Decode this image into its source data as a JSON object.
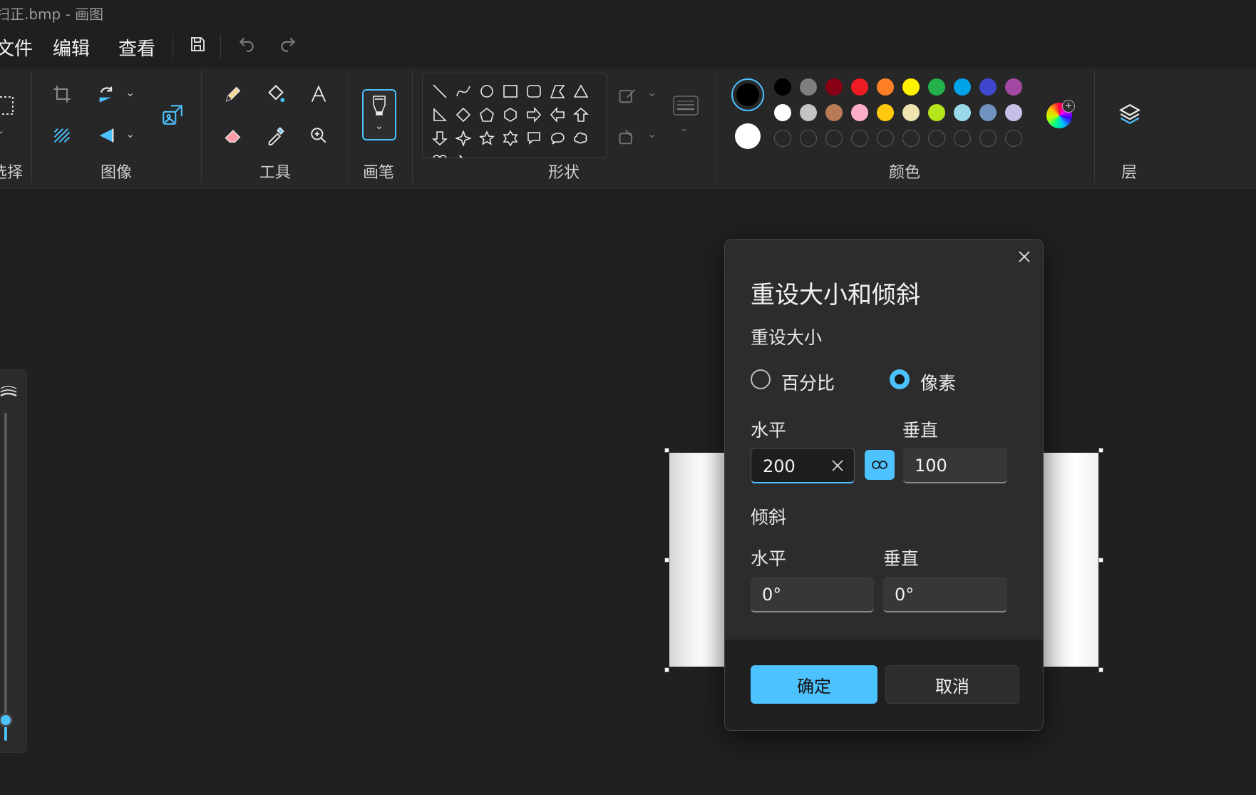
{
  "window": {
    "title": "扫正.bmp - 画图"
  },
  "menu": {
    "items": [
      "文件",
      "编辑",
      "查看"
    ]
  },
  "ribbon": {
    "groups": {
      "selection": "选择",
      "image": "图像",
      "tools": "工具",
      "brushes": "画笔",
      "shapes": "形状",
      "colors": "颜色",
      "layers": "层"
    }
  },
  "colors": {
    "primary": "#000000",
    "secondary": "#ffffff",
    "accent": "#4cc2ff",
    "row1": [
      "#000000",
      "#7f7f7f",
      "#880015",
      "#ed1c24",
      "#ff7f27",
      "#fff200",
      "#22b14c",
      "#00a2e8",
      "#3f48cc",
      "#a349a4"
    ],
    "row2": [
      "#ffffff",
      "#c3c3c3",
      "#b97a57",
      "#ffaec9",
      "#ffc90e",
      "#efe4b0",
      "#b5e61d",
      "#99d9ea",
      "#7092be",
      "#c8bfe7"
    ]
  },
  "dialog": {
    "title": "重设大小和倾斜",
    "resize_heading": "重设大小",
    "option_percent": "百分比",
    "option_pixels": "像素",
    "selected_option": "像素",
    "horizontal_label": "水平",
    "vertical_label": "垂直",
    "resize_horizontal": "200",
    "resize_vertical": "100",
    "skew_heading": "倾斜",
    "skew_horizontal_label": "水平",
    "skew_vertical_label": "垂直",
    "skew_horizontal": "0°",
    "skew_vertical": "0°",
    "ok": "确定",
    "cancel": "取消"
  }
}
